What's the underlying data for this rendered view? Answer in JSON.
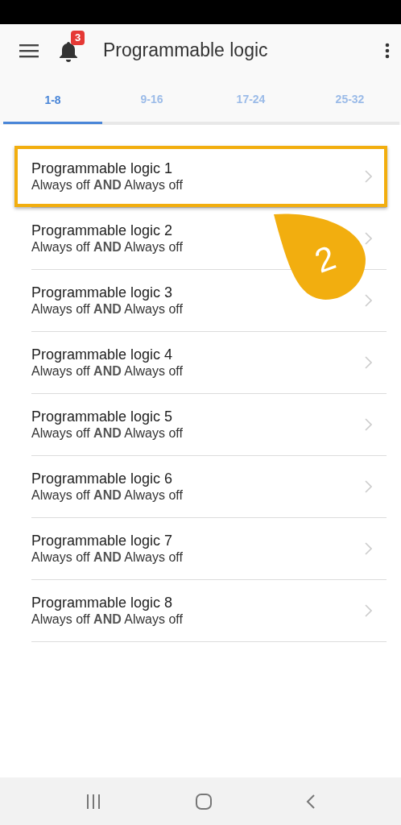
{
  "appbar": {
    "title": "Programmable logic",
    "notification_count": "3"
  },
  "tabs": [
    {
      "label": "1-8",
      "selected": true
    },
    {
      "label": "9-16",
      "selected": false
    },
    {
      "label": "17-24",
      "selected": false
    },
    {
      "label": "25-32",
      "selected": false
    }
  ],
  "items": [
    {
      "title": "Programmable logic 1",
      "subtitle": "Always off **AND** Always off",
      "highlighted": true
    },
    {
      "title": "Programmable logic 2",
      "subtitle": "Always off **AND** Always off",
      "highlighted": false
    },
    {
      "title": "Programmable logic 3",
      "subtitle": "Always off **AND** Always off",
      "highlighted": false
    },
    {
      "title": "Programmable logic 4",
      "subtitle": "Always off **AND** Always off",
      "highlighted": false
    },
    {
      "title": "Programmable logic 5",
      "subtitle": "Always off **AND** Always off",
      "highlighted": false
    },
    {
      "title": "Programmable logic 6",
      "subtitle": "Always off **AND** Always off",
      "highlighted": false
    },
    {
      "title": "Programmable logic 7",
      "subtitle": "Always off **AND** Always off",
      "highlighted": false
    },
    {
      "title": "Programmable logic 8",
      "subtitle": "Always off **AND** Always off",
      "highlighted": false
    }
  ],
  "callout": {
    "text": "2"
  }
}
